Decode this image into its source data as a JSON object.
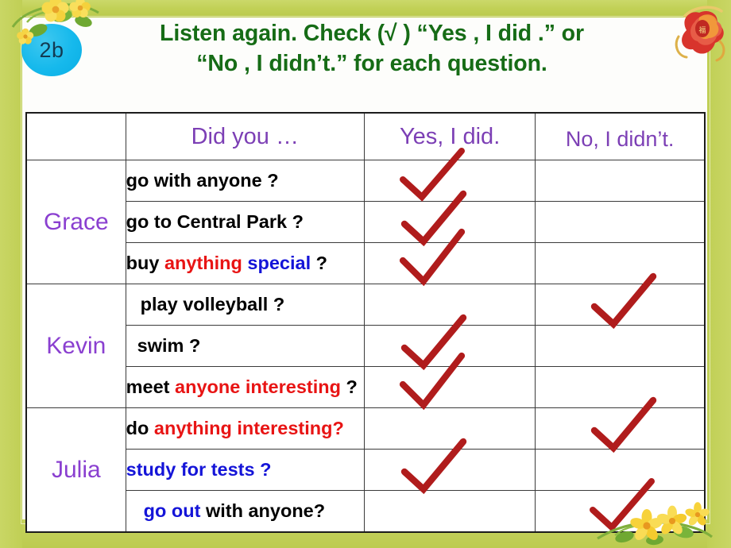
{
  "slide": {
    "badge_label": "2b",
    "title_line1": "Listen again. Check (√ ) “Yes , I did .” or",
    "title_line2": "“No , I didn’t.” for each question.",
    "title_color": "#166c16",
    "badge_color": "#16b9ec",
    "frame_color": "#c2d157",
    "accent_purple": "#7c3fb5",
    "accent_red": "#e81414",
    "accent_blue": "#1414d8",
    "check_color": "#b01c1c"
  },
  "table": {
    "headers": {
      "name": "",
      "question": "Did you …",
      "yes": "Yes, I did.",
      "no": "No, I didn’t."
    },
    "groups": [
      {
        "name": "Grace",
        "rows": [
          {
            "parts": [
              {
                "text": "go with anyone ?",
                "color": "black"
              }
            ],
            "answer": "yes"
          },
          {
            "parts": [
              {
                "text": "go to Central Park ?",
                "color": "black"
              }
            ],
            "answer": "yes"
          },
          {
            "parts": [
              {
                "text": "buy ",
                "color": "black"
              },
              {
                "text": "anything",
                "color": "red"
              },
              {
                "text": " ",
                "color": "black"
              },
              {
                "text": "special",
                "color": "blue"
              },
              {
                "text": " ?",
                "color": "black"
              }
            ],
            "answer": "yes"
          }
        ]
      },
      {
        "name": "Kevin",
        "rows": [
          {
            "parts": [
              {
                "text": "play volleyball ?",
                "color": "black"
              }
            ],
            "answer": "no"
          },
          {
            "parts": [
              {
                "text": "swim ?",
                "color": "black"
              }
            ],
            "answer": "yes"
          },
          {
            "parts": [
              {
                "text": "meet ",
                "color": "black"
              },
              {
                "text": "anyone interesting",
                "color": "red"
              },
              {
                "text": " ?",
                "color": "black"
              }
            ],
            "answer": "yes"
          }
        ]
      },
      {
        "name": "Julia",
        "rows": [
          {
            "parts": [
              {
                "text": "do ",
                "color": "black"
              },
              {
                "text": "anything interesting?",
                "color": "red"
              }
            ],
            "answer": "no"
          },
          {
            "parts": [
              {
                "text": "study for tests ?",
                "color": "blue"
              }
            ],
            "answer": "yes"
          },
          {
            "parts": [
              {
                "text": "go out",
                "color": "blue"
              },
              {
                "text": " with anyone?",
                "color": "black"
              }
            ],
            "answer": "no"
          }
        ]
      }
    ]
  }
}
